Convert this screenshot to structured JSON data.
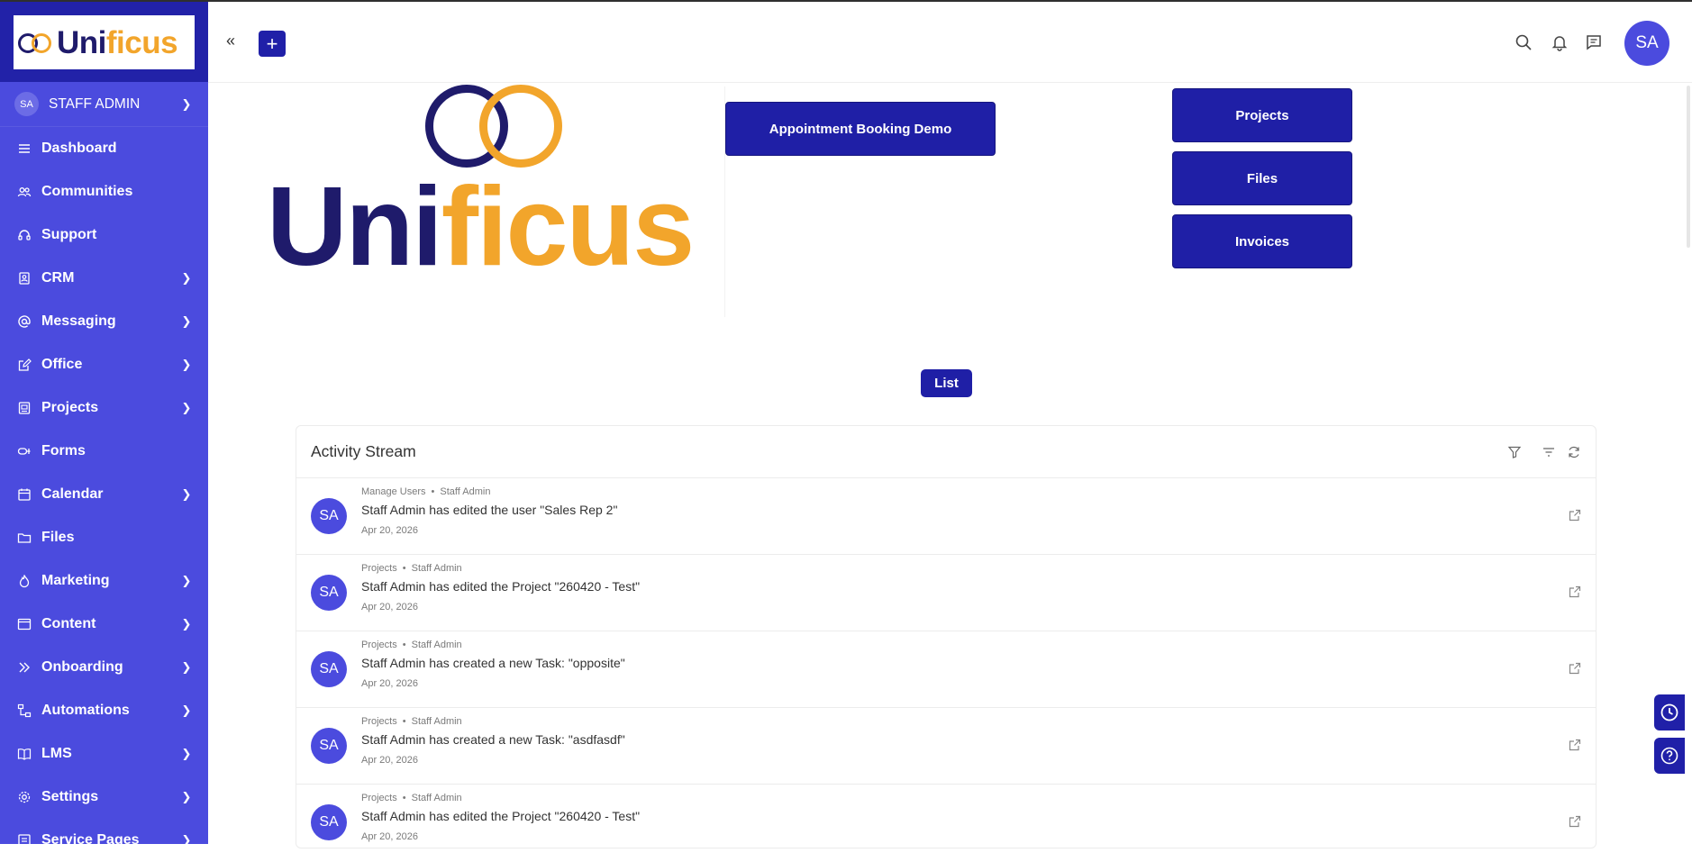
{
  "brand": {
    "name_part1": "Uni",
    "name_part2": "ficus",
    "dark_color": "#1f1b6b",
    "gold_color": "#f2a52b"
  },
  "sidebar": {
    "user": {
      "initials": "SA",
      "name": "STAFF ADMIN"
    },
    "items": [
      {
        "label": "Dashboard",
        "icon": "list-icon",
        "chevron": false
      },
      {
        "label": "Communities",
        "icon": "users-icon",
        "chevron": false
      },
      {
        "label": "Support",
        "icon": "headset-icon",
        "chevron": false
      },
      {
        "label": "CRM",
        "icon": "contact-book-icon",
        "chevron": true
      },
      {
        "label": "Messaging",
        "icon": "at-sign-icon",
        "chevron": true
      },
      {
        "label": "Office",
        "icon": "edit-doc-icon",
        "chevron": true
      },
      {
        "label": "Projects",
        "icon": "project-icon",
        "chevron": true
      },
      {
        "label": "Forms",
        "icon": "form-icon",
        "chevron": false
      },
      {
        "label": "Calendar",
        "icon": "calendar-icon",
        "chevron": true
      },
      {
        "label": "Files",
        "icon": "folder-icon",
        "chevron": false
      },
      {
        "label": "Marketing",
        "icon": "fire-icon",
        "chevron": true
      },
      {
        "label": "Content",
        "icon": "window-icon",
        "chevron": true
      },
      {
        "label": "Onboarding",
        "icon": "double-chevron-icon",
        "chevron": true
      },
      {
        "label": "Automations",
        "icon": "flow-icon",
        "chevron": true
      },
      {
        "label": "LMS",
        "icon": "book-icon",
        "chevron": true
      },
      {
        "label": "Settings",
        "icon": "gear-icon",
        "chevron": true
      },
      {
        "label": "Service Pages",
        "icon": "pages-icon",
        "chevron": true
      }
    ]
  },
  "header": {
    "collapse_glyph": "«",
    "add_glyph": "+",
    "avatar_initials": "SA"
  },
  "hero": {
    "appointment_button": "Appointment Booking Demo",
    "projects_button": "Projects",
    "files_button": "Files",
    "invoices_button": "Invoices",
    "list_button": "List"
  },
  "activity": {
    "title": "Activity Stream",
    "entries": [
      {
        "initials": "SA",
        "module": "Manage Users",
        "actor": "Staff Admin",
        "message": "Staff Admin has edited the user \"Sales Rep 2\"",
        "date": "Apr 20, 2026"
      },
      {
        "initials": "SA",
        "module": "Projects",
        "actor": "Staff Admin",
        "message": "Staff Admin has edited the Project \"260420 - Test\"",
        "date": "Apr 20, 2026"
      },
      {
        "initials": "SA",
        "module": "Projects",
        "actor": "Staff Admin",
        "message": "Staff Admin has created a new Task: \"opposite\"",
        "date": "Apr 20, 2026"
      },
      {
        "initials": "SA",
        "module": "Projects",
        "actor": "Staff Admin",
        "message": "Staff Admin has created a new Task: \"asdfasdf\"",
        "date": "Apr 20, 2026"
      },
      {
        "initials": "SA",
        "module": "Projects",
        "actor": "Staff Admin",
        "message": "Staff Admin has edited the Project \"260420 - Test\"",
        "date": "Apr 20, 2026"
      }
    ]
  },
  "colors": {
    "sidebar": "#4b4bde",
    "sidebar_dark": "#2222a8",
    "primary_button": "#1f1fa6"
  }
}
